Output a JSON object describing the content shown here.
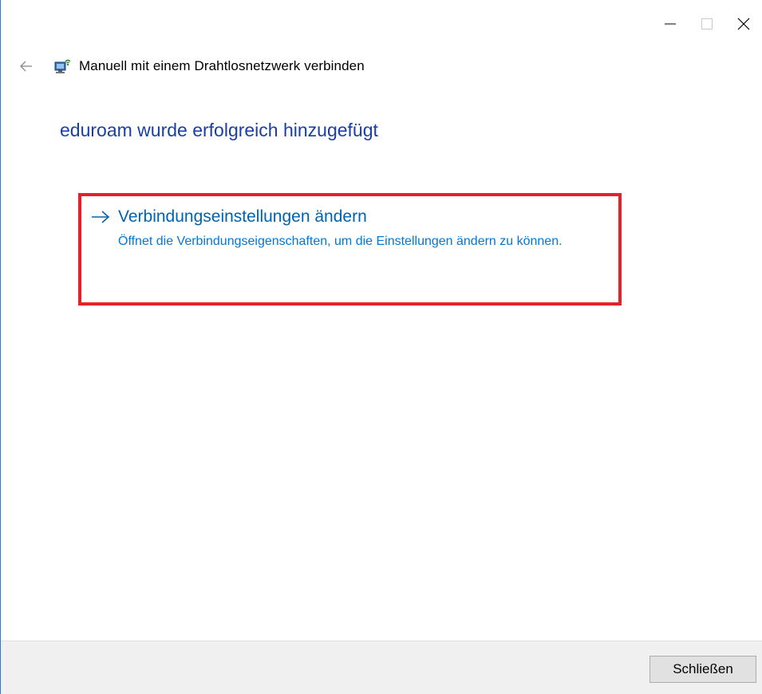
{
  "window": {
    "accent_border_color": "#2b79d6",
    "controls": {
      "minimize_icon": "minimize-icon",
      "maximize_icon": "maximize-icon",
      "close_icon": "close-icon"
    }
  },
  "header": {
    "back_icon": "back-arrow-icon",
    "network_icon": "wireless-network-icon",
    "title": "Manuell mit einem Drahtlosnetzwerk verbinden"
  },
  "main": {
    "heading": "eduroam wurde erfolgreich hinzugefügt",
    "heading_color": "#1a3fa0",
    "task": {
      "arrow_icon": "right-arrow-icon",
      "title": "Verbindungseinstellungen ändern",
      "description": "Öffnet die Verbindungseigenschaften, um die Einstellungen ändern zu können.",
      "link_color": "#0063b1"
    },
    "highlight_color": "#e8202a"
  },
  "footer": {
    "close_button_label": "Schließen"
  }
}
